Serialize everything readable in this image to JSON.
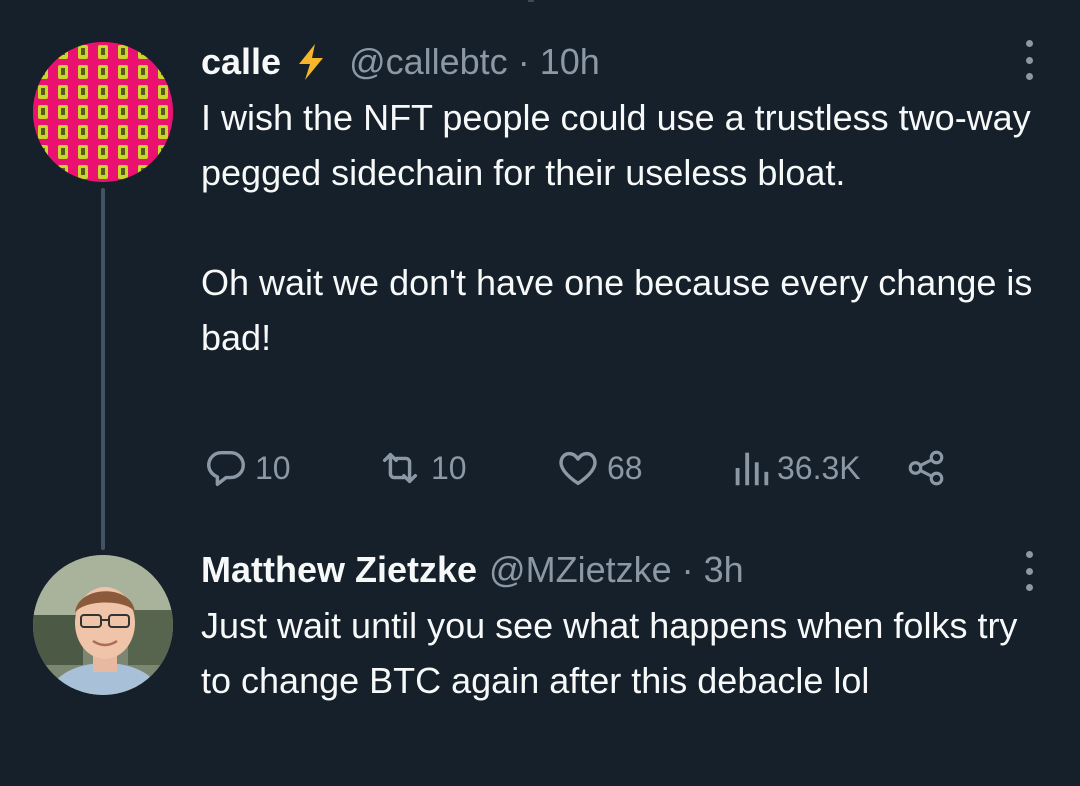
{
  "tweets": [
    {
      "display_name": "calle",
      "handle": "@callebtc",
      "separator": "·",
      "time": "10h",
      "body_paragraphs": [
        "I wish the NFT people could use a trustless two-way pegged sidechain for their useless bloat.",
        "Oh wait we don't have one because every change is bad!"
      ],
      "actions": {
        "replies": "10",
        "retweets": "10",
        "likes": "68",
        "views": "36.3K"
      },
      "badge_icon": "lightning-bolt-icon",
      "badge_color": "#f7b529"
    },
    {
      "display_name": "Matthew Zietzke",
      "handle": "@MZietzke",
      "separator": "·",
      "time": "3h",
      "body_paragraphs": [
        "Just wait until you see what happens when folks try to change BTC again after this debacle lol"
      ]
    }
  ],
  "colors": {
    "background": "#15202b",
    "text": "#f7f9f9",
    "secondary_text": "#8b98a5",
    "thread_line": "#425364"
  },
  "icons": [
    "reply-icon",
    "retweet-icon",
    "like-icon",
    "views-icon",
    "share-icon",
    "more-options-icon"
  ]
}
